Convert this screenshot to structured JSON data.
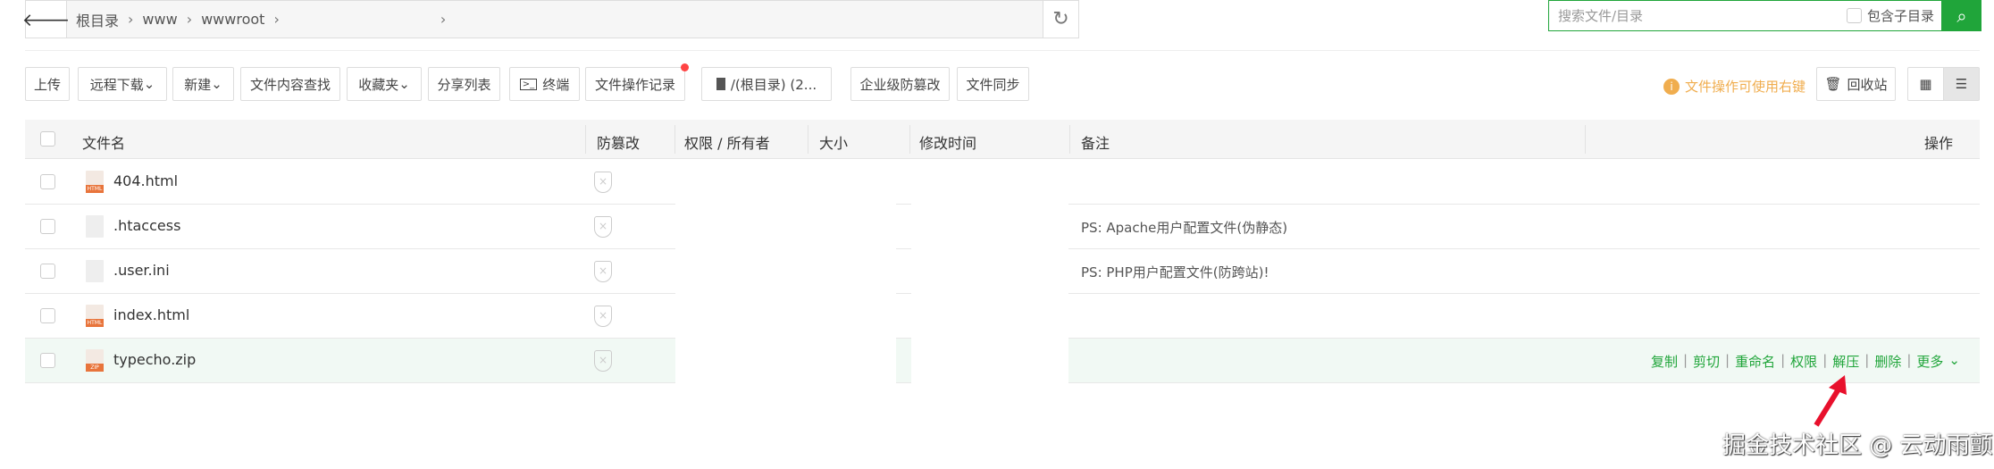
{
  "breadcrumb": {
    "items": [
      "根目录",
      "www",
      "wwwroot",
      ""
    ]
  },
  "search": {
    "placeholder": "搜索文件/目录",
    "include_sub": "包含子目录"
  },
  "toolbar": {
    "upload": "上传",
    "remote_download": "远程下载",
    "new": "新建",
    "content_search": "文件内容查找",
    "favorites": "收藏夹",
    "share_list": "分享列表",
    "terminal": "终端",
    "op_log": "文件操作记录",
    "disk": "/(根目录) (2...",
    "tamper": "企业级防篡改",
    "sync": "文件同步",
    "tip": "文件操作可使用右键",
    "recycle": "回收站"
  },
  "table": {
    "headers": {
      "name": "文件名",
      "tamper": "防篡改",
      "perm": "权限 / 所有者",
      "size": "大小",
      "mtime": "修改时间",
      "remark": "备注",
      "ops": "操作"
    },
    "rows": [
      {
        "name": "404.html",
        "type": "html",
        "remark": ""
      },
      {
        "name": ".htaccess",
        "type": "text",
        "remark": "PS: Apache用户配置文件(伪静态)"
      },
      {
        "name": ".user.ini",
        "type": "text",
        "remark": "PS: PHP用户配置文件(防跨站)!"
      },
      {
        "name": "index.html",
        "type": "html",
        "remark": ""
      },
      {
        "name": "typecho.zip",
        "type": "zip",
        "remark": ""
      }
    ],
    "row_ops": [
      "复制",
      "剪切",
      "重命名",
      "权限",
      "解压",
      "删除",
      "更多"
    ]
  },
  "watermark": "掘金技术社区 @ 云动雨颤"
}
